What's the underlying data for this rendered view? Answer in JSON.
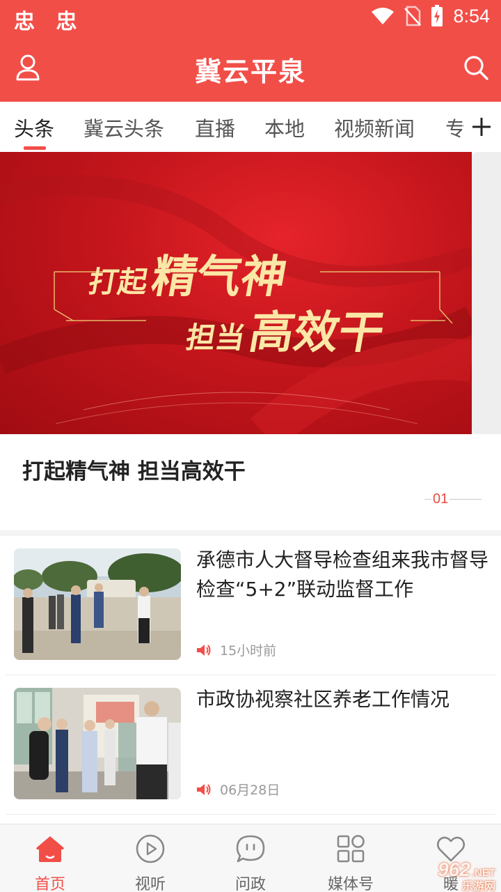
{
  "status_bar": {
    "left_icons": "忠 忠",
    "time": "8:54"
  },
  "header": {
    "title": "冀云平泉"
  },
  "tabs": [
    {
      "label": "头条",
      "active": true
    },
    {
      "label": "冀云头条",
      "active": false
    },
    {
      "label": "直播",
      "active": false
    },
    {
      "label": "本地",
      "active": false
    },
    {
      "label": "视频新闻",
      "active": false
    },
    {
      "label": "专",
      "active": false
    }
  ],
  "banner": {
    "line1_a": "打起",
    "line1_b": "精气神",
    "line2_a": "担当",
    "line2_b": "高效干",
    "caption": "打起精气神 担当高效干",
    "index": "01"
  },
  "news": [
    {
      "title": "承德市人大督导检查组来我市督导检查“5+2”联动监督工作",
      "time": "15小时前"
    },
    {
      "title": "市政协视察社区养老工作情况",
      "time": "06月28日"
    }
  ],
  "bottom_nav": [
    {
      "label": "首页",
      "icon": "home-icon",
      "active": true
    },
    {
      "label": "视听",
      "icon": "play-icon",
      "active": false
    },
    {
      "label": "问政",
      "icon": "chat-icon",
      "active": false
    },
    {
      "label": "媒体号",
      "icon": "grid-icon",
      "active": false
    },
    {
      "label": "暖",
      "icon": "heart-icon",
      "active": false
    }
  ],
  "watermark": {
    "main": "962",
    "suffix": ".NET",
    "sub": "乐游网"
  },
  "colors": {
    "brand_red": "#f24e48",
    "text_dark": "#222222",
    "text_muted": "#999999"
  }
}
